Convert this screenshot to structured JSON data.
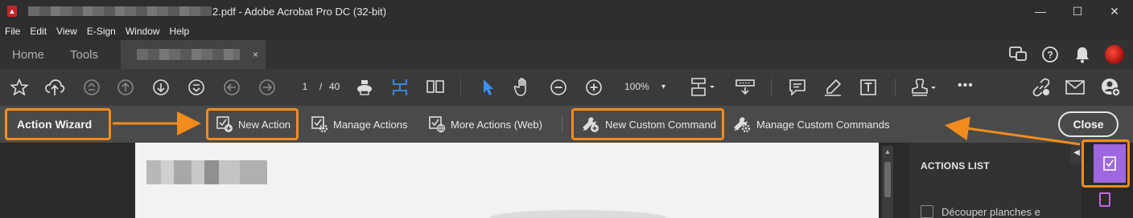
{
  "window": {
    "title_suffix": "2.pdf - Adobe Acrobat Pro DC (32-bit)",
    "controls": {
      "minimize": "—",
      "maximize": "☐",
      "close": "✕"
    }
  },
  "menu": [
    "File",
    "Edit",
    "View",
    "E-Sign",
    "Window",
    "Help"
  ],
  "tabs": {
    "home": "Home",
    "tools": "Tools",
    "doc_close": "×"
  },
  "toolbar": {
    "page_current": "1",
    "page_sep": "/",
    "page_total": "40",
    "zoom": "100%",
    "zoom_caret": "▾",
    "more": "•••"
  },
  "action_wizard": {
    "label": "Action Wizard",
    "new_action": "New Action",
    "manage_actions": "Manage Actions",
    "more_actions": "More Actions (Web)",
    "new_custom_command": "New Custom Command",
    "manage_custom_commands": "Manage Custom Commands",
    "close": "Close"
  },
  "right_panel": {
    "heading": "ACTIONS LIST",
    "first_item": "Découper planches e"
  },
  "colors": {
    "highlight": "#f28c1e",
    "accent_blue": "#3d8ff0",
    "panel_purple": "#9e67e0"
  },
  "icons": [
    "acrobat-app-icon",
    "star-icon",
    "upload-cloud-icon",
    "previous-page-icon",
    "next-page-icon",
    "print-icon",
    "fit-page-icon",
    "select-cursor-icon",
    "hand-icon",
    "zoom-out-icon",
    "zoom-in-icon",
    "comment-icon",
    "highlight-pen-icon",
    "text-box-icon",
    "stamp-icon",
    "link-icon",
    "email-icon",
    "add-user-icon"
  ]
}
